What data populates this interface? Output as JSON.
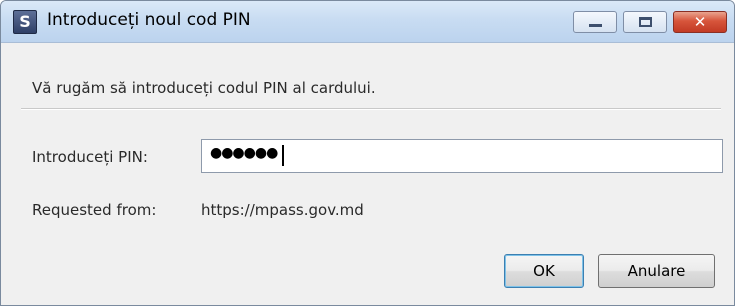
{
  "window": {
    "title": "Introduceți noul cod PIN",
    "app_icon_glyph": "S",
    "controls": {
      "minimize": "minimize",
      "maximize": "maximize",
      "close": "✕"
    }
  },
  "dialog": {
    "instruction": "Vă rugăm să introduceți codul PIN al cardului.",
    "pin_label": "Introduceți PIN:",
    "pin_mask": "●●●●●●",
    "requested_from_label": "Requested from:",
    "requested_from_value": "https://mpass.gov.md"
  },
  "buttons": {
    "ok": "OK",
    "cancel": "Anulare"
  },
  "colors": {
    "title_bar": "#c8dcf2",
    "close_button": "#d7553b",
    "default_button_border": "#3c7fb1",
    "background": "#f0f0f0"
  }
}
